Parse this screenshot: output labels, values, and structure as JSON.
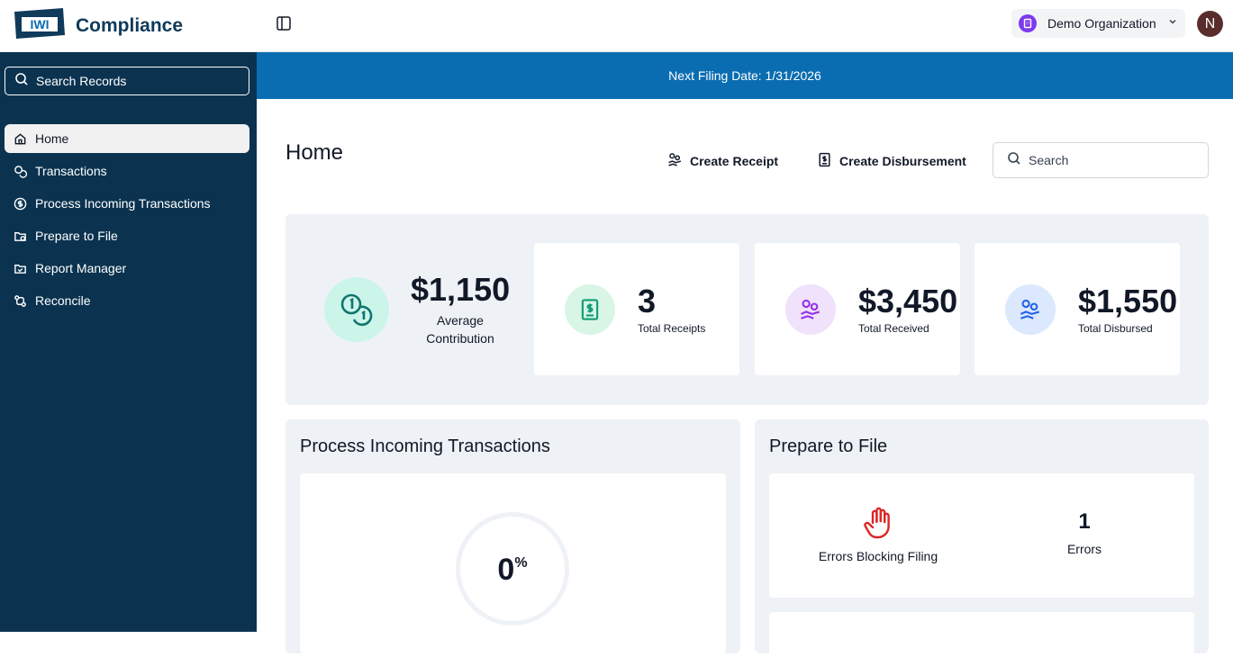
{
  "header": {
    "logo_text": "IWI",
    "app_name": "Compliance",
    "organization": "Demo Organization",
    "avatar_initial": "N"
  },
  "sidebar": {
    "search_label": "Search Records",
    "items": [
      {
        "label": "Home",
        "icon": "home-icon",
        "active": true
      },
      {
        "label": "Transactions",
        "icon": "coins-icon"
      },
      {
        "label": "Process Incoming Transactions",
        "icon": "dollar-circle-icon"
      },
      {
        "label": "Prepare to File",
        "icon": "folder-clock-icon"
      },
      {
        "label": "Report Manager",
        "icon": "folder-check-icon"
      },
      {
        "label": "Reconcile",
        "icon": "git-compare-icon"
      }
    ]
  },
  "banner": {
    "text": "Next Filing Date: 1/31/2026"
  },
  "main": {
    "title": "Home",
    "create_receipt": "Create Receipt",
    "create_disbursement": "Create Disbursement",
    "search_placeholder": "Search"
  },
  "stats": {
    "average": {
      "value": "$1,150",
      "label": "Average Contribution"
    },
    "receipts": {
      "value": "3",
      "label": "Total Receipts"
    },
    "received": {
      "value": "$3,450",
      "label": "Total Received"
    },
    "disbursed": {
      "value": "$1,550",
      "label": "Total Disbursed"
    }
  },
  "process_panel": {
    "title": "Process Incoming Transactions",
    "percent": "0",
    "percent_sign": "%"
  },
  "prepare_panel": {
    "title": "Prepare to File",
    "errors_label": "Errors Blocking Filing",
    "errors_count": "1",
    "errors_count_label": "Errors"
  },
  "colors": {
    "sidebar_bg": "#0b3350",
    "banner_bg": "#0b6db1",
    "panel_bg": "#eef2f6",
    "green_accent": "#0f9d74",
    "purple_accent": "#7c3aed",
    "blue_accent": "#2563eb",
    "error_red": "#dc2626"
  }
}
